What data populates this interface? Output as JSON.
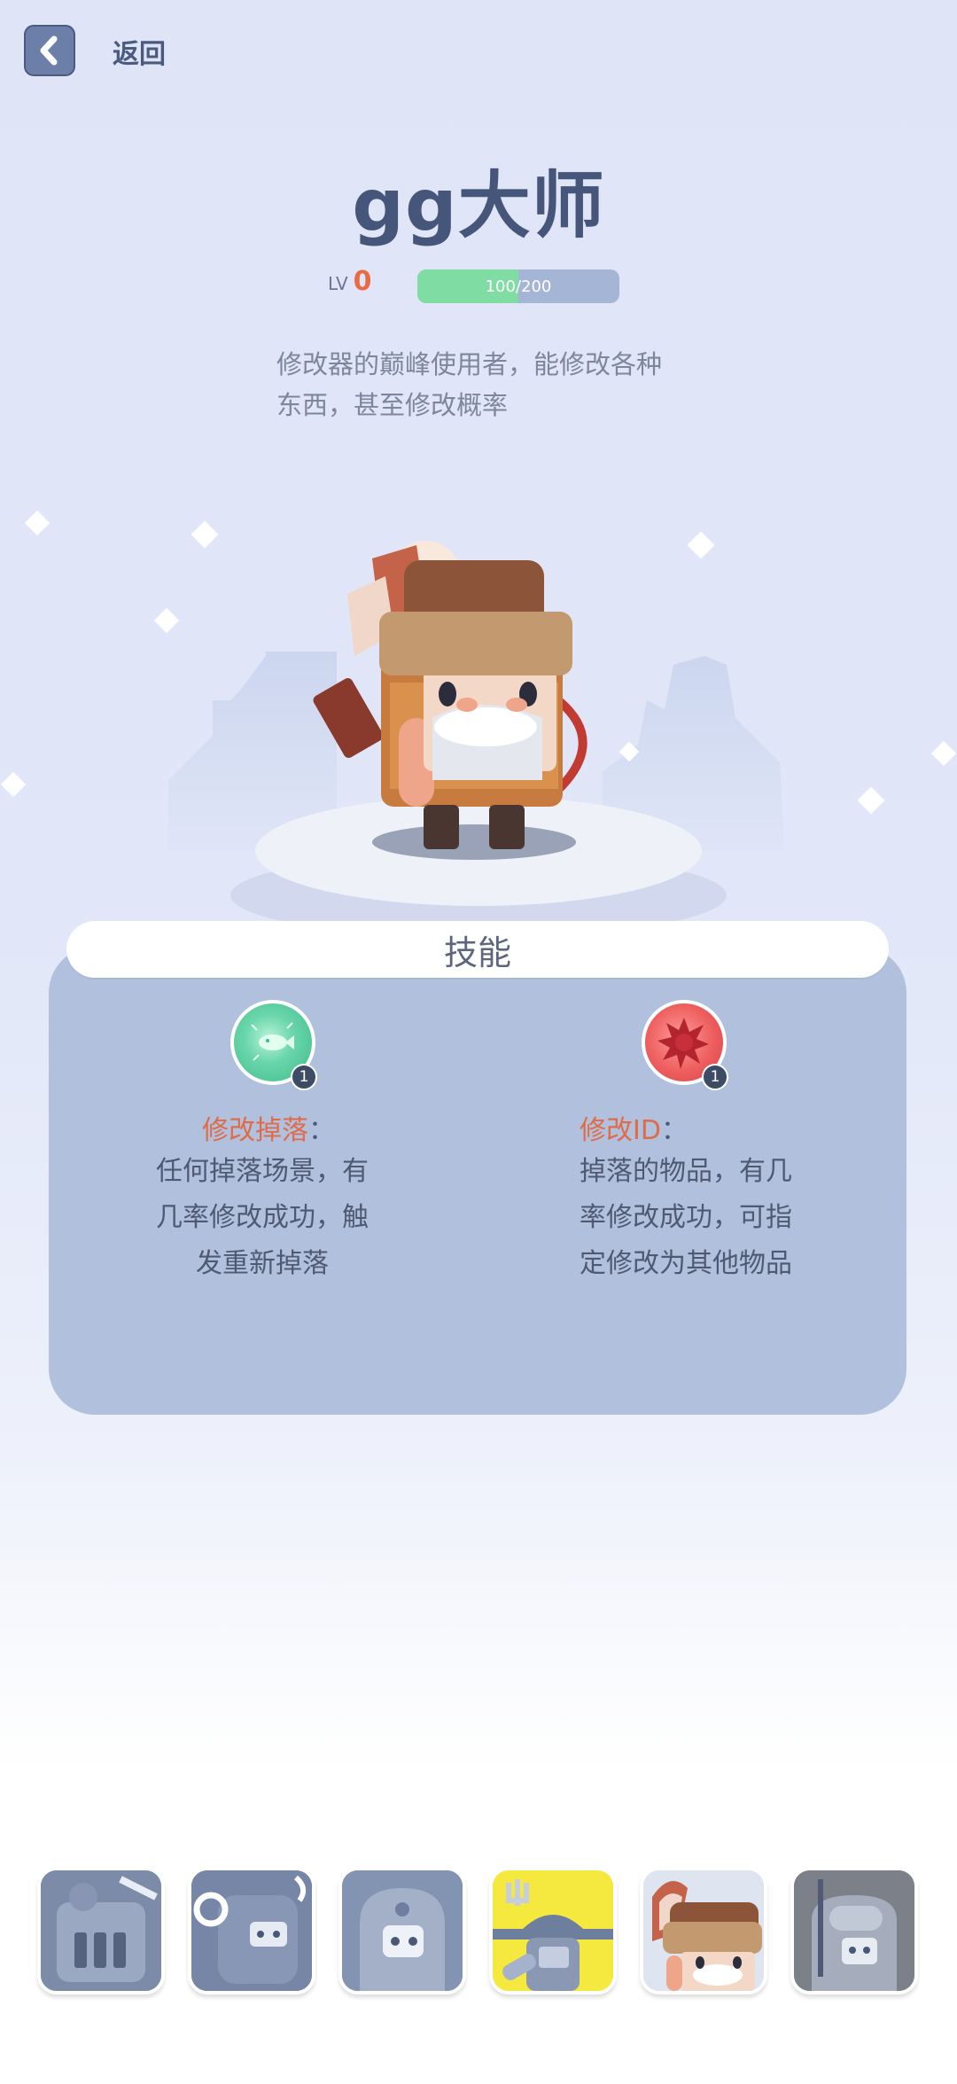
{
  "header": {
    "back_label": "返回"
  },
  "character": {
    "name": "gg大师",
    "level_prefix": "LV",
    "level": "0",
    "xp_text": "100/200",
    "xp_fraction": 0.5,
    "description": [
      "修改器的巅峰使用者，能修改各种",
      "东西，甚至修改概率"
    ]
  },
  "skills": {
    "title": "技能",
    "items": [
      {
        "name": "修改掉落",
        "colon": "：",
        "level": "1",
        "lines": [
          "任何掉落场景，有",
          "几率修改成功，触",
          "发重新掉落"
        ],
        "color": "#4fc79a"
      },
      {
        "name": "修改ID",
        "colon": "：",
        "level": "1",
        "lines": [
          "掉落的物品，有几",
          "率修改成功，可指",
          "定修改为其他物品"
        ],
        "color": "#e3575a"
      }
    ]
  },
  "colors": {
    "accent": "#e86b45",
    "panel": "#b0c0dd",
    "title": "#46557a",
    "selected_card": "#f5e93f"
  }
}
